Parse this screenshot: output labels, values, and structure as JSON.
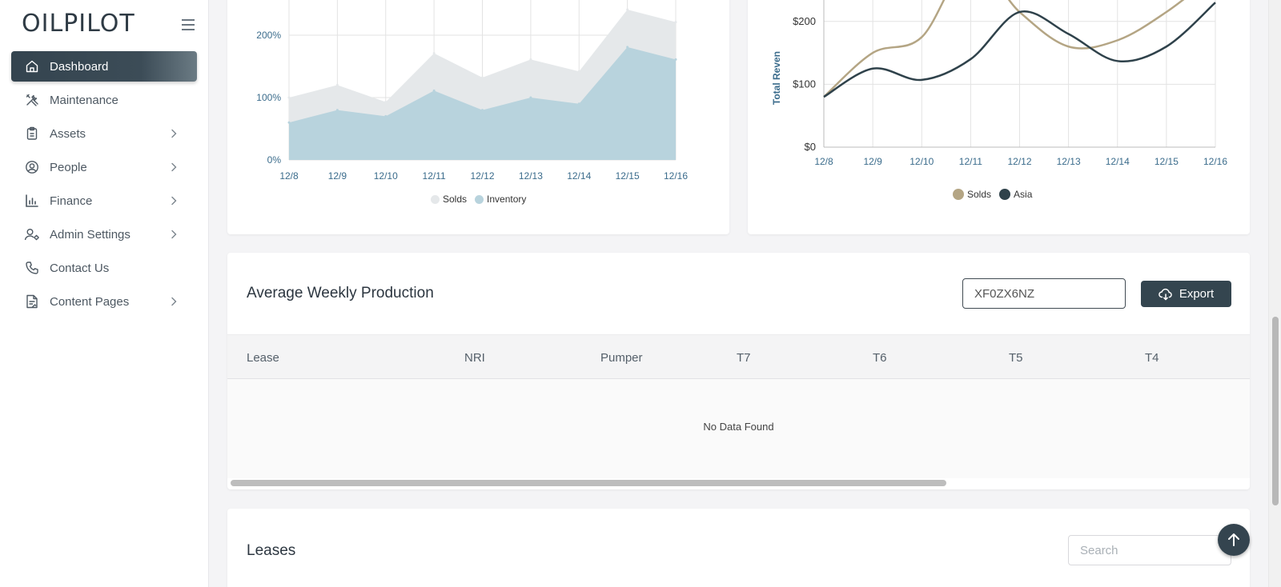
{
  "app": {
    "logo": "OILPILOT"
  },
  "sidebar": {
    "items": [
      {
        "label": "Dashboard",
        "icon": "home-icon",
        "active": true,
        "has_children": false
      },
      {
        "label": "Maintenance",
        "icon": "tools-icon",
        "active": false,
        "has_children": false
      },
      {
        "label": "Assets",
        "icon": "clipboard-icon",
        "active": false,
        "has_children": true
      },
      {
        "label": "People",
        "icon": "user-circle-icon",
        "active": false,
        "has_children": true
      },
      {
        "label": "Finance",
        "icon": "bar-chart-icon",
        "active": false,
        "has_children": true
      },
      {
        "label": "Admin Settings",
        "icon": "user-gear-icon",
        "active": false,
        "has_children": true
      },
      {
        "label": "Contact Us",
        "icon": "phone-icon",
        "active": false,
        "has_children": false
      },
      {
        "label": "Content Pages",
        "icon": "document-icon",
        "active": false,
        "has_children": true
      }
    ]
  },
  "chart_data": [
    {
      "type": "area",
      "categories": [
        "12/8",
        "12/9",
        "12/10",
        "12/11",
        "12/12",
        "12/13",
        "12/14",
        "12/15",
        "12/16"
      ],
      "series": [
        {
          "name": "Solds",
          "values": [
            100,
            120,
            93,
            171,
            132,
            161,
            142,
            241,
            221
          ],
          "color": "#e5e8ea"
        },
        {
          "name": "Inventory",
          "values": [
            60,
            80,
            70,
            111,
            80,
            100,
            90,
            181,
            161
          ],
          "color": "#b8d3dd"
        }
      ],
      "yticks": [
        "0%",
        "100%",
        "200%"
      ],
      "ylim": [
        0,
        240
      ],
      "legend": "bottom",
      "grid": true
    },
    {
      "type": "line",
      "categories": [
        "12/8",
        "12/9",
        "12/10",
        "12/11",
        "12/12",
        "12/13",
        "12/14",
        "12/15",
        "12/16"
      ],
      "series": [
        {
          "name": "Solds",
          "values": [
            80,
            150,
            175,
            295,
            215,
            160,
            170,
            215,
            275
          ],
          "color": "#b4a584"
        },
        {
          "name": "Asia",
          "values": [
            80,
            125,
            107,
            140,
            215,
            180,
            137,
            160,
            230
          ],
          "color": "#2f424b"
        }
      ],
      "yticks": [
        "$0",
        "$100",
        "$200"
      ],
      "ylabel": "Total Reven",
      "ylim": [
        0,
        230
      ],
      "legend": "bottom",
      "grid": true
    }
  ],
  "production": {
    "title": "Average Weekly Production",
    "code_value": "XF0ZX6NZ",
    "export_label": "Export",
    "columns": [
      "Lease",
      "NRI",
      "Pumper",
      "T7",
      "T6",
      "T5",
      "T4"
    ],
    "empty_text": "No Data Found"
  },
  "leases": {
    "title": "Leases",
    "search_placeholder": "Search"
  }
}
